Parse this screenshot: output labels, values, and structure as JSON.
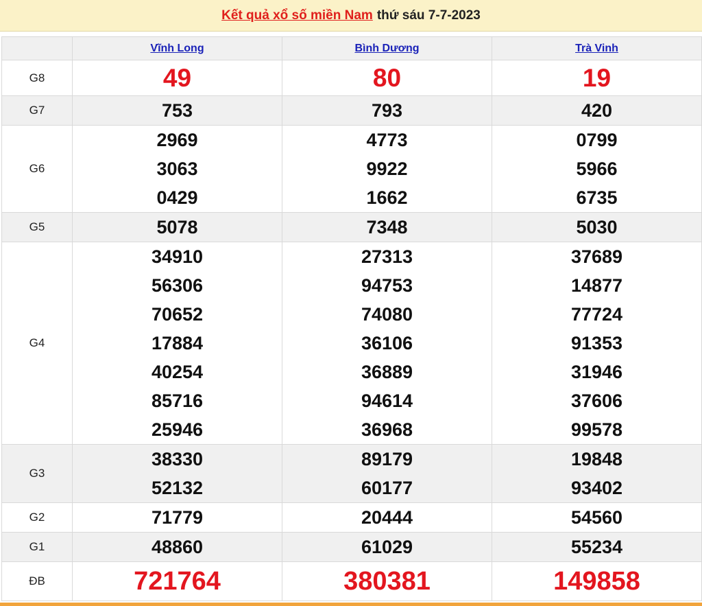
{
  "header": {
    "link_text": "Kết quả xổ số miền Nam",
    "rest_text": "thứ sáu 7-7-2023"
  },
  "provinces": [
    "Vĩnh Long",
    "Bình Dương",
    "Trà Vinh"
  ],
  "rows": [
    {
      "label": "G8",
      "values": [
        [
          "49"
        ],
        [
          "80"
        ],
        [
          "19"
        ]
      ]
    },
    {
      "label": "G7",
      "values": [
        [
          "753"
        ],
        [
          "793"
        ],
        [
          "420"
        ]
      ]
    },
    {
      "label": "G6",
      "values": [
        [
          "2969",
          "3063",
          "0429"
        ],
        [
          "4773",
          "9922",
          "1662"
        ],
        [
          "0799",
          "5966",
          "6735"
        ]
      ]
    },
    {
      "label": "G5",
      "values": [
        [
          "5078"
        ],
        [
          "7348"
        ],
        [
          "5030"
        ]
      ]
    },
    {
      "label": "G4",
      "values": [
        [
          "34910",
          "56306",
          "70652",
          "17884",
          "40254",
          "85716",
          "25946"
        ],
        [
          "27313",
          "94753",
          "74080",
          "36106",
          "36889",
          "94614",
          "36968"
        ],
        [
          "37689",
          "14877",
          "77724",
          "91353",
          "31946",
          "37606",
          "99578"
        ]
      ]
    },
    {
      "label": "G3",
      "values": [
        [
          "38330",
          "52132"
        ],
        [
          "89179",
          "60177"
        ],
        [
          "19848",
          "93402"
        ]
      ]
    },
    {
      "label": "G2",
      "values": [
        [
          "71779"
        ],
        [
          "20444"
        ],
        [
          "54560"
        ]
      ]
    },
    {
      "label": "G1",
      "values": [
        [
          "48860"
        ],
        [
          "61029"
        ],
        [
          "55234"
        ]
      ]
    },
    {
      "label": "ĐB",
      "values": [
        [
          "721764"
        ],
        [
          "380381"
        ],
        [
          "149858"
        ]
      ]
    }
  ],
  "colors": {
    "header_bg": "#fbf2c8",
    "accent_red": "#e3161f",
    "link_blue": "#1a22b8",
    "bottom_bar": "#f1a43c"
  }
}
